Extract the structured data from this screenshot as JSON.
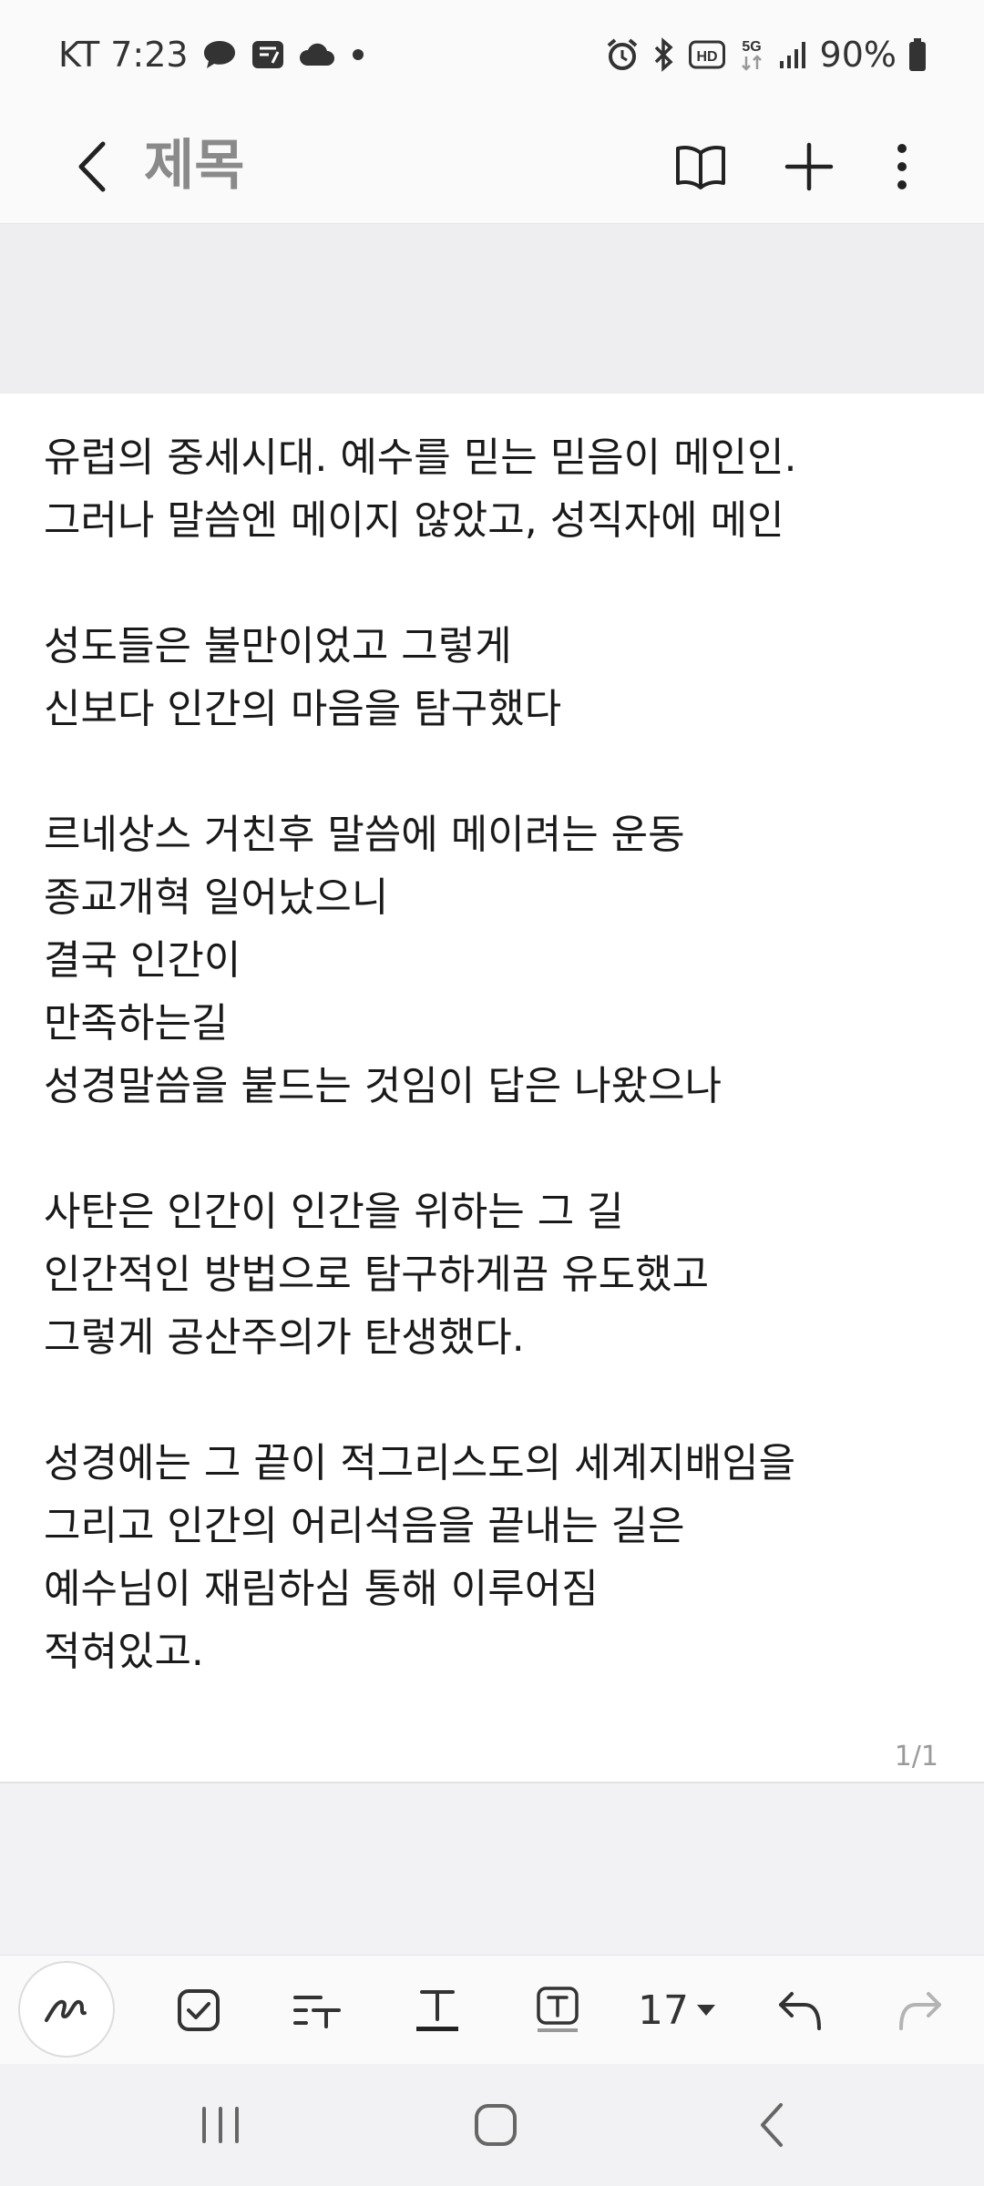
{
  "status_bar": {
    "carrier_time": "KT 7:23",
    "battery": "90%",
    "left_icons": [
      "messenger-icon",
      "note-app-icon",
      "cloud-icon",
      "dot-icon"
    ],
    "right_icons": [
      "alarm-icon",
      "bluetooth-icon",
      "hd-icon",
      "5g-icon",
      "signal-icon",
      "battery-icon"
    ],
    "hd_label": "HD",
    "network_label": "5G"
  },
  "app_bar": {
    "title": "제목",
    "icons": [
      "back-icon",
      "book-icon",
      "plus-icon",
      "more-vertical-icon"
    ]
  },
  "note": {
    "lines": [
      "유럽의 중세시대. 예수를 믿는 믿음이 메인인.",
      "그러나 말씀엔 메이지 않았고, 성직자에 메인",
      "",
      "성도들은 불만이었고 그렇게",
      "신보다 인간의 마음을 탐구했다",
      "",
      "르네상스 거친후 말씀에 메이려는 운동",
      "종교개혁 일어났으니",
      "결국 인간이",
      "만족하는길",
      "성경말씀을 붙드는 것임이 답은 나왔으나",
      "",
      "사탄은 인간이 인간을 위하는 그 길",
      "인간적인 방법으로 탐구하게끔 유도했고",
      "그렇게 공산주의가 탄생했다.",
      "",
      "성경에는 그 끝이 적그리스도의 세계지배임을",
      "그리고 인간의 어리석음을 끝내는 길은",
      "예수님이 재림하심 통해 이루어짐",
      "적혀있고."
    ],
    "page_indicator": "1/1"
  },
  "toolbar": {
    "font_size": "17",
    "icons": [
      "pen-icon",
      "checkbox-icon",
      "text-format-icon",
      "text-style-icon",
      "text-box-icon",
      "undo-icon",
      "redo-icon"
    ]
  },
  "nav_bar": {
    "icons": [
      "recents-icon",
      "home-icon",
      "back-nav-icon"
    ]
  },
  "colors": {
    "accent_text": "#1a1a1a",
    "title_gray": "#8a8a8a",
    "background": "#f2f2f4",
    "page": "#ffffff"
  }
}
